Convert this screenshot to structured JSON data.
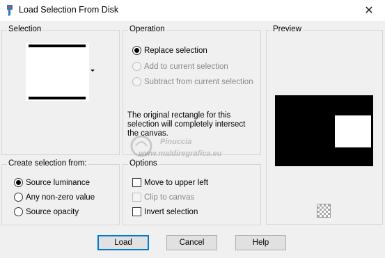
{
  "window": {
    "title": "Load Selection From Disk",
    "close_glyph": "✕",
    "app_icon": "paintbrush-icon"
  },
  "selection_group": {
    "label": "Selection"
  },
  "operation_group": {
    "label": "Operation",
    "options": [
      {
        "label": "Replace selection",
        "checked": true,
        "enabled": true
      },
      {
        "label": "Add to current selection",
        "checked": false,
        "enabled": false
      },
      {
        "label": "Subtract from current selection",
        "checked": false,
        "enabled": false
      }
    ],
    "description": "The original rectangle for this selection will completely intersect the canvas."
  },
  "preview_group": {
    "label": "Preview",
    "transparency_icon": "checkerboard-icon"
  },
  "create_group": {
    "label": "Create selection from:",
    "options": [
      {
        "label": "Source luminance",
        "checked": true
      },
      {
        "label": "Any non-zero value",
        "checked": false
      },
      {
        "label": "Source opacity",
        "checked": false
      }
    ]
  },
  "options_group": {
    "label": "Options",
    "items": [
      {
        "label": "Move to upper left",
        "checked": false,
        "enabled": true
      },
      {
        "label": "Clip to canvas",
        "checked": false,
        "enabled": false
      },
      {
        "label": "Invert selection",
        "checked": false,
        "enabled": true
      }
    ]
  },
  "buttons": {
    "load": "Load",
    "cancel": "Cancel",
    "help": "Help"
  },
  "watermark": {
    "line1": "Pinuccia",
    "line2": "www.maldiregrafica.eu"
  },
  "colors": {
    "default_button_border": "#0078d7",
    "dialog_background": "#f0f0f0"
  }
}
